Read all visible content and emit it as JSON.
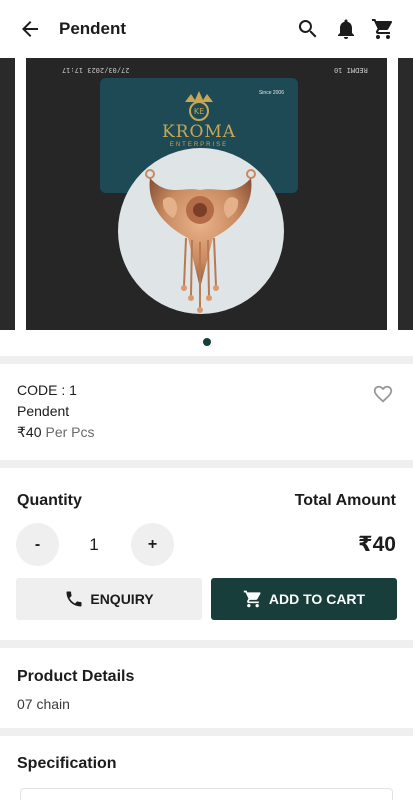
{
  "appbar": {
    "title": "Pendent",
    "icons": [
      "back-arrow-icon",
      "search-icon",
      "bell-icon",
      "cart-icon"
    ]
  },
  "gallery": {
    "photo_stamp_left": "27/03/2023 17:17",
    "photo_stamp_right": "REDMI 10",
    "card_brand": "KROMA",
    "card_sub": "ENTERPRISE",
    "card_logo": "KE",
    "card_since": "Since 2006",
    "active_page": 1,
    "page_count": 1
  },
  "product": {
    "code": "CODE : 1",
    "name": "Pendent",
    "price": "₹40",
    "unit": "Per Pcs"
  },
  "order": {
    "quantity_label": "Quantity",
    "total_label": "Total Amount",
    "minus_label": "-",
    "plus_label": "+",
    "quantity": "1",
    "total_value": "₹40",
    "enquiry_label": "ENQUIRY",
    "add_to_cart_label": "ADD TO CART"
  },
  "details": {
    "title": "Product Details",
    "text": "07 chain"
  },
  "specification": {
    "title": "Specification"
  },
  "colors": {
    "primary": "#173E3B",
    "surface": "#FFFFFF",
    "background": "#EFEFEF"
  }
}
